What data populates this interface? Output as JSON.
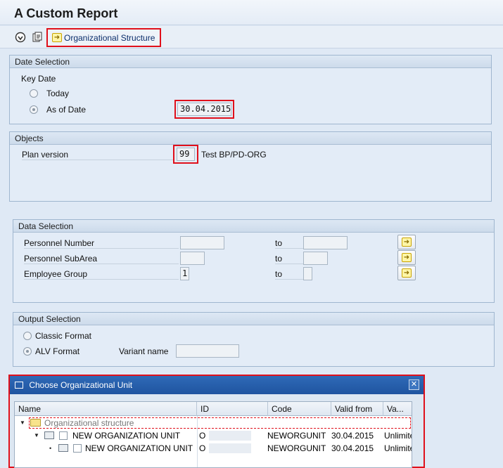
{
  "window": {
    "title": "A Custom Report"
  },
  "toolbar": {
    "org_structure_label": "Organizational Structure"
  },
  "date_selection": {
    "heading": "Date Selection",
    "key_date_label": "Key Date",
    "today_label": "Today",
    "as_of_date_label": "As of Date",
    "as_of_date_value": "30.04.2015"
  },
  "objects": {
    "heading": "Objects",
    "plan_version_label": "Plan version",
    "plan_version_value": "99",
    "plan_version_text": "Test BP/PD-ORG"
  },
  "data_selection": {
    "heading": "Data Selection",
    "to_label": "to",
    "rows": [
      {
        "label": "Personnel Number",
        "from": "",
        "to": ""
      },
      {
        "label": "Personnel SubArea",
        "from": "",
        "to": ""
      },
      {
        "label": "Employee Group",
        "from": "1",
        "to": ""
      }
    ]
  },
  "output_selection": {
    "heading": "Output Selection",
    "classic_label": "Classic Format",
    "alv_label": "ALV Format",
    "variant_label": "Variant name",
    "variant_value": ""
  },
  "dialog": {
    "title": "Choose Organizational Unit",
    "columns": [
      "Name",
      "ID",
      "Code",
      "Valid from",
      "Va..."
    ],
    "root_label": "Organizational structure",
    "rows": [
      {
        "name": "NEW ORGANIZATION UNIT",
        "id": "O",
        "code": "NEWORGUNIT",
        "valid_from": "30.04.2015",
        "valid_to": "Unlimited"
      },
      {
        "name": "NEW ORGANIZATION UNIT",
        "id": "O",
        "code": "NEWORGUNIT",
        "valid_from": "30.04.2015",
        "valid_to": "Unlimited"
      }
    ]
  },
  "colors": {
    "highlight": "#e0101b",
    "dialog_header": "#2a62ae",
    "background": "#dfe9f5"
  }
}
